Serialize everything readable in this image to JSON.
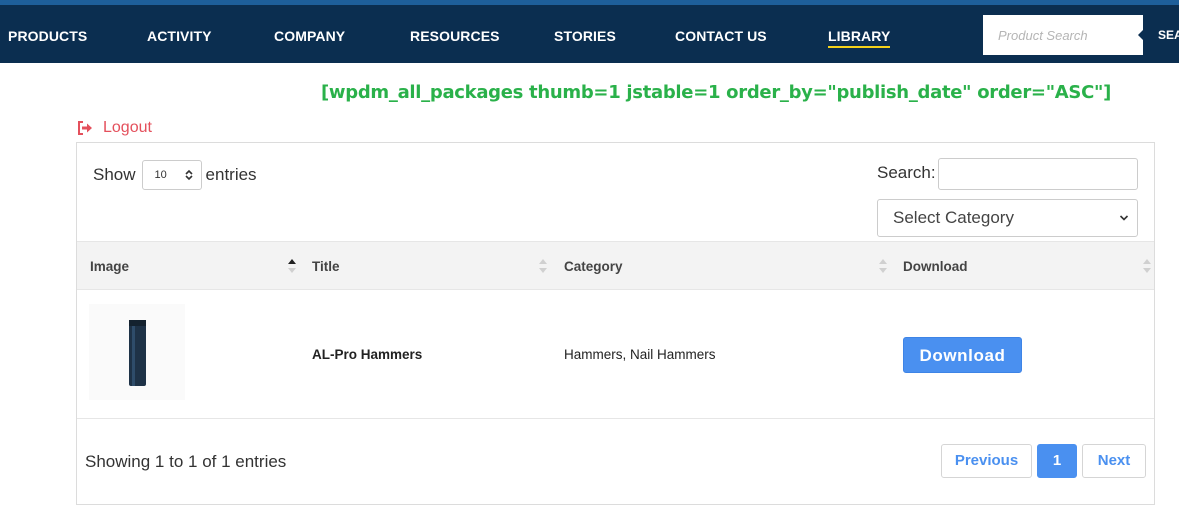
{
  "nav": {
    "items": [
      {
        "label": "PRODUCTS"
      },
      {
        "label": "ACTIVITY"
      },
      {
        "label": "COMPANY"
      },
      {
        "label": "RESOURCES"
      },
      {
        "label": "STORIES"
      },
      {
        "label": "CONTACT US"
      },
      {
        "label": "LIBRARY",
        "active": true
      }
    ],
    "search_placeholder": "Product Search",
    "search_button": "SEARCH"
  },
  "shortcode_text": "[wpdm_all_packages thumb=1 jstable=1 order_by=\"publish_date\" order=\"ASC\"]",
  "logout": {
    "label": "Logout",
    "icon": "sign-out-icon"
  },
  "table_controls": {
    "show_label": "Show",
    "entries_value": "10",
    "entries_label": "entries",
    "search_label": "Search:",
    "category_select": "Select Category"
  },
  "table": {
    "columns": [
      "Image",
      "Title",
      "Category",
      "Download"
    ],
    "rows": [
      {
        "title": "AL-Pro Hammers",
        "category": "Hammers, Nail Hammers",
        "download": "Download"
      }
    ]
  },
  "footer": {
    "info": "Showing 1 to 1 of 1 entries",
    "previous": "Previous",
    "current_page": "1",
    "next": "Next"
  },
  "colors": {
    "nav_bg": "#0b2e50",
    "accent": "#4a90f0",
    "shortcode": "#2ab14a",
    "logout": "#e4505c"
  }
}
